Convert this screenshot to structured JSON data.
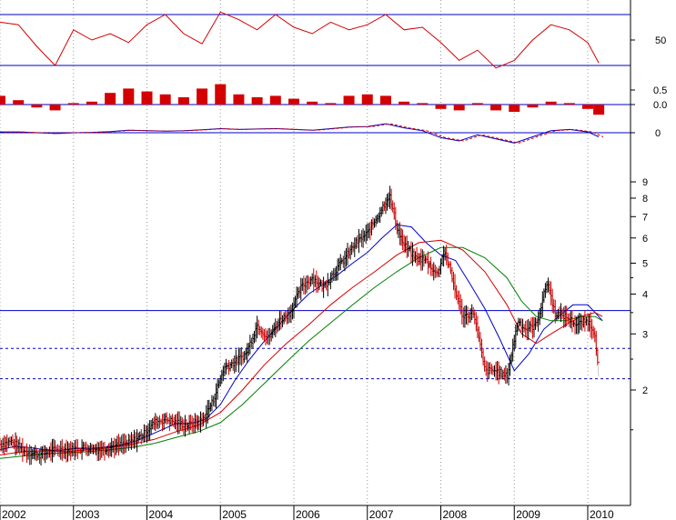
{
  "chart_data": [
    {
      "type": "line",
      "panel": "rsi-oscillator",
      "colors": {
        "line": "#d40000",
        "guide": "#0000c8"
      },
      "ylabels": [
        "50"
      ],
      "guide_lines": [
        70,
        30
      ],
      "series": [
        {
          "x": [
            2002.0,
            2002.25,
            2002.5,
            2002.75,
            2003.0,
            2003.25,
            2003.5,
            2003.75,
            2004.0,
            2004.25,
            2004.5,
            2004.75,
            2005.0,
            2005.25,
            2005.5,
            2005.75,
            2006.0,
            2006.25,
            2006.5,
            2006.75,
            2007.0,
            2007.25,
            2007.5,
            2007.75,
            2008.0,
            2008.25,
            2008.5,
            2008.75,
            2009.0,
            2009.25,
            2009.5,
            2009.75,
            2010.0,
            2010.15
          ],
          "values": [
            64,
            62,
            45,
            30,
            58,
            50,
            55,
            48,
            62,
            70,
            55,
            47,
            72,
            66,
            58,
            70,
            60,
            55,
            64,
            58,
            62,
            70,
            58,
            60,
            48,
            34,
            42,
            28,
            34,
            50,
            62,
            58,
            48,
            32
          ]
        }
      ]
    },
    {
      "type": "bar",
      "panel": "histogram-oscillator",
      "colors": {
        "bar": "#d40000",
        "zero": "#0000c8"
      },
      "ylabels": [
        "0.5",
        "0.0"
      ],
      "series": [
        {
          "x": [
            2002.0,
            2002.25,
            2002.5,
            2002.75,
            2003.0,
            2003.25,
            2003.5,
            2003.75,
            2004.0,
            2004.25,
            2004.5,
            2004.75,
            2005.0,
            2005.25,
            2005.5,
            2005.75,
            2006.0,
            2006.25,
            2006.5,
            2006.75,
            2007.0,
            2007.25,
            2007.5,
            2007.75,
            2008.0,
            2008.25,
            2008.5,
            2008.75,
            2009.0,
            2009.25,
            2009.5,
            2009.75,
            2010.0,
            2010.15
          ],
          "values": [
            0.3,
            0.15,
            -0.1,
            -0.2,
            0.05,
            0.1,
            0.4,
            0.55,
            0.45,
            0.35,
            0.25,
            0.55,
            0.7,
            0.35,
            0.25,
            0.3,
            0.2,
            0.1,
            0.05,
            0.3,
            0.35,
            0.3,
            0.1,
            0.05,
            -0.15,
            -0.2,
            0.05,
            -0.2,
            -0.25,
            -0.1,
            0.1,
            0.05,
            -0.15,
            -0.35
          ]
        }
      ]
    },
    {
      "type": "line",
      "panel": "macd-oscillator",
      "colors": {
        "line": "#0000c8",
        "signal": "#d40000"
      },
      "ylabels": [
        "0"
      ],
      "series": [
        {
          "x": [
            2002.0,
            2002.25,
            2002.5,
            2002.75,
            2003.0,
            2003.25,
            2003.5,
            2003.75,
            2004.0,
            2004.25,
            2004.5,
            2004.75,
            2005.0,
            2005.25,
            2005.5,
            2005.75,
            2006.0,
            2006.25,
            2006.5,
            2006.75,
            2007.0,
            2007.25,
            2007.5,
            2007.75,
            2008.0,
            2008.25,
            2008.5,
            2008.75,
            2009.0,
            2009.25,
            2009.5,
            2009.75,
            2010.0,
            2010.15
          ],
          "values": [
            0.02,
            0.02,
            0.0,
            -0.02,
            0.0,
            0.01,
            0.03,
            0.06,
            0.05,
            0.04,
            0.05,
            0.07,
            0.1,
            0.08,
            0.09,
            0.1,
            0.08,
            0.06,
            0.1,
            0.14,
            0.15,
            0.22,
            0.12,
            0.05,
            -0.12,
            -0.2,
            -0.05,
            -0.15,
            -0.25,
            -0.1,
            0.05,
            0.08,
            0.02,
            -0.1
          ]
        }
      ]
    },
    {
      "type": "line",
      "panel": "price",
      "scale": "log",
      "colors": {
        "up": "#000000",
        "down": "#d40000",
        "ma_fast": "#0000c8",
        "ma_mid": "#d40000",
        "ma_slow": "#008000",
        "guide": "#0000c8"
      },
      "x_ticks": [
        "2002",
        "2003",
        "2004",
        "2005",
        "2006",
        "2007",
        "2008",
        "2009",
        "2010"
      ],
      "y_ticks": [
        "9",
        "8",
        "7",
        "6",
        "5",
        "4",
        "3",
        "2"
      ],
      "ylim": [
        1.1,
        10.0
      ],
      "horizontal_lines": [
        {
          "value": 3.55,
          "style": "solid"
        },
        {
          "value": 2.7,
          "style": "dashed"
        },
        {
          "value": 2.17,
          "style": "dashed"
        }
      ],
      "series": [
        {
          "x": [
            2002.0,
            2002.15,
            2002.35,
            2002.55,
            2002.75,
            2002.95,
            2003.15,
            2003.35,
            2003.55,
            2003.75,
            2003.95,
            2004.1,
            2004.25,
            2004.4,
            2004.55,
            2004.75,
            2004.9,
            2005.05,
            2005.2,
            2005.35,
            2005.5,
            2005.65,
            2005.8,
            2005.95,
            2006.1,
            2006.25,
            2006.4,
            2006.55,
            2006.7,
            2006.85,
            2007.0,
            2007.15,
            2007.3,
            2007.4,
            2007.5,
            2007.65,
            2007.8,
            2007.95,
            2008.05,
            2008.2,
            2008.3,
            2008.45,
            2008.6,
            2008.75,
            2008.9,
            2009.05,
            2009.15,
            2009.3,
            2009.45,
            2009.55,
            2009.7,
            2009.85,
            2010.0,
            2010.1,
            2010.15
          ],
          "values": [
            1.35,
            1.38,
            1.28,
            1.25,
            1.3,
            1.3,
            1.32,
            1.3,
            1.33,
            1.36,
            1.45,
            1.58,
            1.62,
            1.58,
            1.55,
            1.6,
            1.85,
            2.35,
            2.45,
            2.6,
            3.2,
            2.9,
            3.3,
            3.5,
            4.2,
            4.5,
            4.2,
            4.7,
            5.2,
            5.8,
            6.2,
            7.1,
            8.2,
            6.5,
            5.7,
            5.2,
            5.1,
            4.6,
            5.5,
            4.1,
            3.4,
            3.5,
            2.3,
            2.3,
            2.2,
            3.3,
            3.1,
            3.2,
            4.4,
            3.5,
            3.4,
            3.2,
            3.3,
            3.0,
            2.2
          ]
        },
        {
          "x": [
            2002.0,
            2002.2,
            2002.4,
            2002.6,
            2002.8,
            2003.0,
            2003.2,
            2003.4,
            2003.6,
            2003.8,
            2004.0,
            2004.2,
            2004.4,
            2004.6,
            2004.8,
            2005.0,
            2005.2,
            2005.4,
            2005.6,
            2005.8,
            2006.0,
            2006.2,
            2006.4,
            2006.6,
            2006.8,
            2007.0,
            2007.2,
            2007.4,
            2007.6,
            2007.8,
            2008.0,
            2008.2,
            2008.4,
            2008.6,
            2008.8,
            2009.0,
            2009.2,
            2009.4,
            2009.6,
            2009.8,
            2010.0,
            2010.1,
            2010.2
          ],
          "values": [
            1.3,
            1.33,
            1.32,
            1.3,
            1.29,
            1.31,
            1.31,
            1.32,
            1.34,
            1.37,
            1.43,
            1.5,
            1.57,
            1.57,
            1.62,
            1.8,
            2.15,
            2.5,
            2.85,
            3.2,
            3.6,
            4.0,
            4.3,
            4.6,
            5.0,
            5.4,
            6.0,
            6.6,
            6.5,
            5.8,
            5.3,
            5.1,
            4.3,
            3.6,
            2.9,
            2.3,
            2.6,
            3.1,
            3.4,
            3.7,
            3.7,
            3.5,
            3.3
          ]
        },
        {
          "x": [
            2002.0,
            2002.3,
            2002.6,
            2002.9,
            2003.2,
            2003.5,
            2003.8,
            2004.1,
            2004.4,
            2004.7,
            2005.0,
            2005.3,
            2005.6,
            2005.9,
            2006.2,
            2006.5,
            2006.8,
            2007.1,
            2007.4,
            2007.7,
            2008.0,
            2008.3,
            2008.6,
            2008.9,
            2009.1,
            2009.3,
            2009.5,
            2009.7,
            2009.9,
            2010.1,
            2010.2
          ],
          "values": [
            1.25,
            1.28,
            1.29,
            1.28,
            1.3,
            1.32,
            1.35,
            1.4,
            1.48,
            1.55,
            1.7,
            2.0,
            2.4,
            2.8,
            3.2,
            3.7,
            4.2,
            4.7,
            5.3,
            5.8,
            5.9,
            5.5,
            4.7,
            3.7,
            3.0,
            2.8,
            3.0,
            3.2,
            3.4,
            3.5,
            3.4
          ]
        },
        {
          "x": [
            2002.0,
            2002.3,
            2002.6,
            2002.9,
            2003.2,
            2003.5,
            2003.8,
            2004.1,
            2004.4,
            2004.7,
            2005.0,
            2005.3,
            2005.6,
            2005.9,
            2006.2,
            2006.5,
            2006.8,
            2007.1,
            2007.4,
            2007.7,
            2008.0,
            2008.3,
            2008.6,
            2008.9,
            2009.1,
            2009.3,
            2009.5,
            2009.7,
            2009.9,
            2010.1,
            2010.2
          ],
          "values": [
            1.22,
            1.24,
            1.26,
            1.27,
            1.28,
            1.3,
            1.32,
            1.36,
            1.42,
            1.48,
            1.58,
            1.8,
            2.1,
            2.45,
            2.85,
            3.25,
            3.7,
            4.2,
            4.7,
            5.2,
            5.6,
            5.6,
            5.2,
            4.5,
            3.8,
            3.4,
            3.3,
            3.3,
            3.4,
            3.4,
            3.3
          ]
        }
      ]
    }
  ]
}
